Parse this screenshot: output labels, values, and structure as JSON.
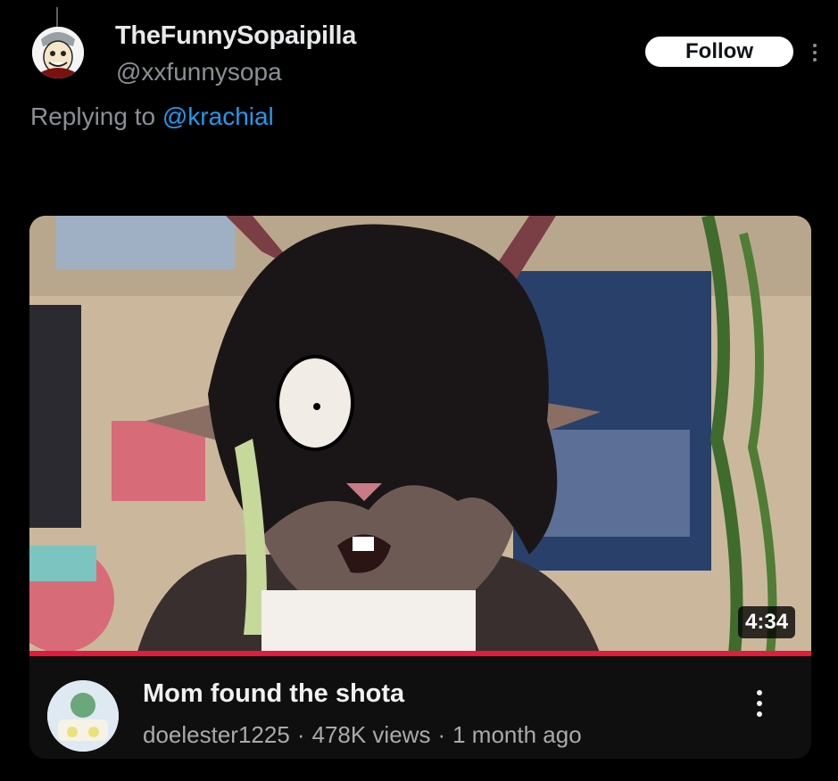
{
  "tweet": {
    "author_name": "TheFunnySopaipilla",
    "author_handle": "@xxfunnysopa",
    "follow_label": "Follow",
    "replying_prefix": "Replying to",
    "replying_to": "@krachial"
  },
  "video": {
    "duration": "4:34",
    "title": "Mom found the shota",
    "channel": "doelester1225",
    "separator": "·",
    "views": "478K views",
    "age": "1 month ago",
    "progress_fraction": 1.0
  },
  "colors": {
    "background": "#000000",
    "handle_grey": "#8b9096",
    "mention_blue": "#1d9bf0",
    "progress_red": "#e51a3c"
  },
  "icons": [
    "avatar",
    "more-dots-icon",
    "video-more-icon"
  ]
}
